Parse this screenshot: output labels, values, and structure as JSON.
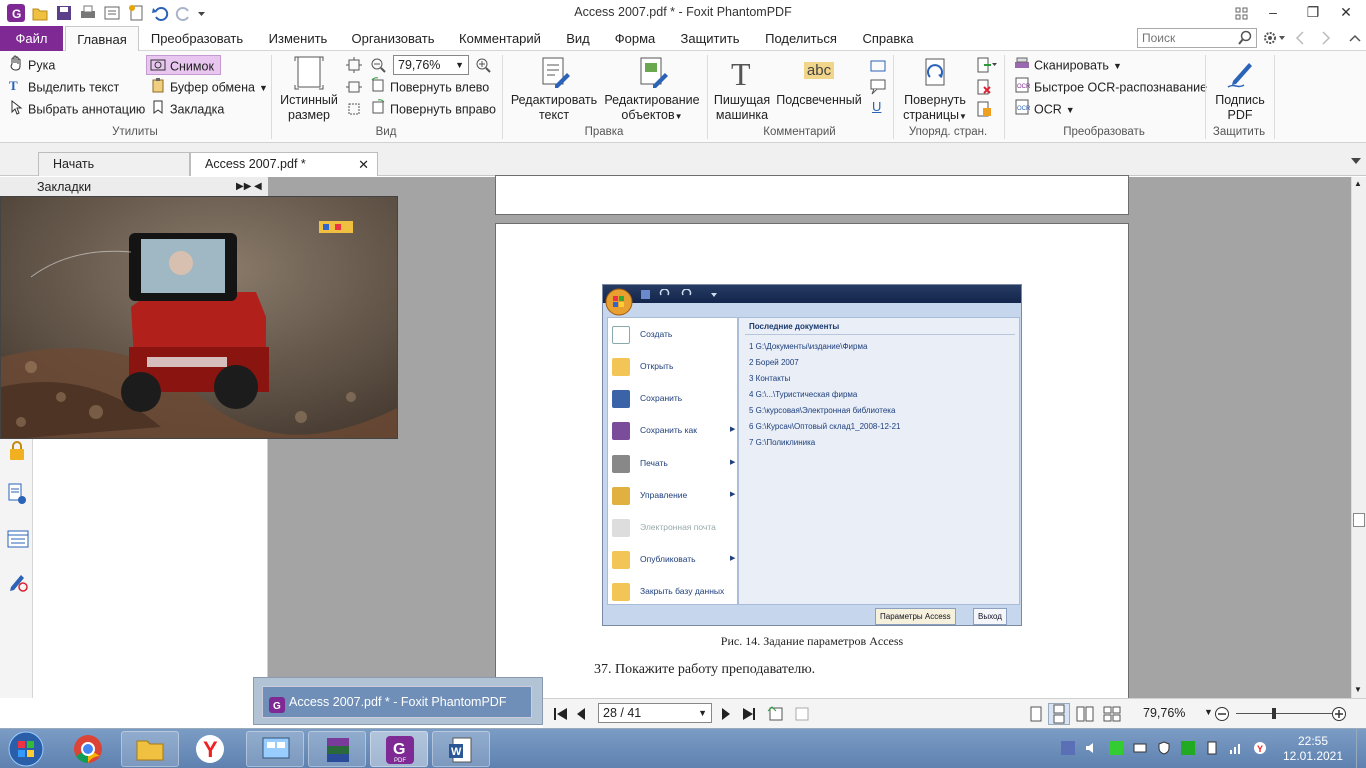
{
  "window": {
    "title": "Access 2007.pdf * - Foxit PhantomPDF",
    "minimize": "–",
    "maximize": "❐",
    "close": "✕"
  },
  "menu": {
    "file": "Файл",
    "tabs": [
      "Главная",
      "Преобразовать",
      "Изменить",
      "Организовать",
      "Комментарий",
      "Вид",
      "Форма",
      "Защитить",
      "Поделиться",
      "Справка"
    ],
    "search_placeholder": "Поиск"
  },
  "ribbon": {
    "utilities": {
      "hand": "Рука",
      "select_text": "Выделить текст",
      "select_annot": "Выбрать аннотацию",
      "snapshot": "Снимок",
      "clipboard": "Буфер обмена",
      "bookmark": "Закладка",
      "label": "Утилиты"
    },
    "view": {
      "actual_size_1": "Истинный",
      "actual_size_2": "размер",
      "zoom": "79,76%",
      "rotate_left": "Повернуть влево",
      "rotate_right": "Повернуть вправо",
      "label": "Вид"
    },
    "edit": {
      "edit_text_1": "Редактировать",
      "edit_text_2": "текст",
      "edit_obj_1": "Редактирование",
      "edit_obj_2": "объектов",
      "label": "Правка"
    },
    "comment": {
      "typewriter_1": "Пишущая",
      "typewriter_2": "машинка",
      "highlight": "Подсвеченный",
      "abc": "abc",
      "label": "Комментарий"
    },
    "pages": {
      "rotate_1": "Повернуть",
      "rotate_2": "страницы",
      "label": "Упоряд. стран."
    },
    "convert": {
      "scan": "Сканировать",
      "quick_ocr": "Быстрое OCR-распознавание",
      "ocr": "OCR",
      "label": "Преобразовать"
    },
    "protect": {
      "sign_1": "Подпись",
      "sign_2": "PDF",
      "label": "Защитить"
    }
  },
  "doc_tabs": {
    "start": "Начать",
    "current": "Access 2007.pdf *"
  },
  "bookmarks": {
    "title": "Закладки"
  },
  "access_window": {
    "menu_items": [
      "Создать",
      "Открыть",
      "Сохранить",
      "Сохранить как",
      "Печать",
      "Управление",
      "Электронная почта",
      "Опубликовать",
      "Закрыть базу данных"
    ],
    "recent_title": "Последние документы",
    "recent": [
      "1 G:\\Документы\\издание\\Фирма",
      "2 Борей 2007",
      "3 Контакты",
      "4 G:\\...\\Туристическая фирма",
      "5 G:\\курсовая\\Электронная библиотека",
      "6 G:\\Курсач\\Оптовый склад1_2008-12-21",
      "7 G:\\Поликлиника"
    ],
    "options_button": "Параметры Access",
    "exit_button": "Выход"
  },
  "page_text": {
    "caption": "Рис. 14. Задание параметров Access",
    "task": "37. Покажите работу преподавателю."
  },
  "taskbar_preview": {
    "title": "Access 2007.pdf * - Foxit PhantomPDF"
  },
  "status": {
    "page": "28 / 41",
    "zoom": "79,76%",
    "zoom_fraction": 0.4
  },
  "clock": {
    "time": "22:55",
    "date": "12.01.2021"
  },
  "colors": {
    "file_tab": "#7f2a94",
    "accent": "#2a63b8",
    "taskbar": "#6d8fbc"
  }
}
